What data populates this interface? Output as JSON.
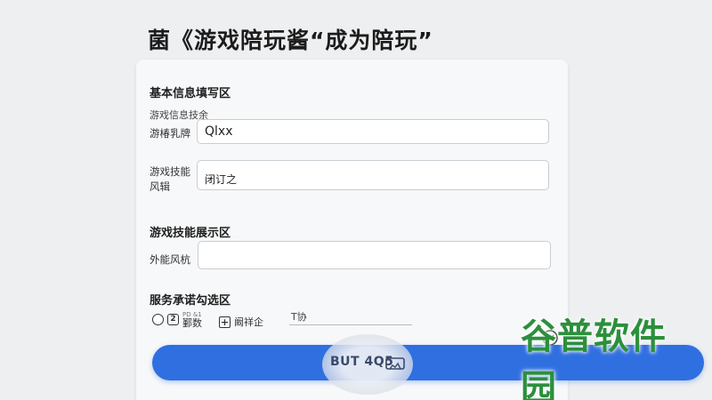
{
  "header": {
    "title": "菌《游戏陪玩酱“成为陪玩”"
  },
  "basic_section": {
    "title": "基本信息填写区",
    "subtitle": "游戏信息技余",
    "field1": {
      "label": "游椿乳牌",
      "value": "Qlxx"
    },
    "field2": {
      "label": "游戏技能风辑",
      "value": "闭订之"
    }
  },
  "skill_section": {
    "title": "游戏技能展示区",
    "field": {
      "label": "外能风杭",
      "value": ""
    }
  },
  "service_section": {
    "title": "服务承诺勾选区",
    "option1_small": "PD &1",
    "option1_label": "鄞数",
    "option2_label": "阚祥企",
    "input_value": "T协"
  },
  "submit": {
    "label": "BUT 4Q5"
  },
  "watermark": {
    "text": "谷普软件园"
  },
  "icons": [
    "radio-circle-icon",
    "badge-icon",
    "plus-box-icon",
    "card-icon",
    "cursor-icon"
  ],
  "colors": {
    "primary": "#2f6fe0",
    "watermark": "#2c8f3c"
  }
}
